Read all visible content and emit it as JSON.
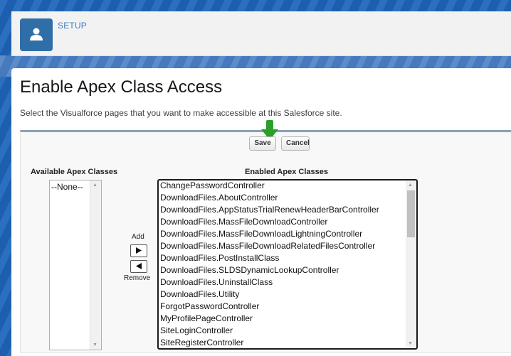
{
  "header": {
    "title": "SETUP",
    "icon": "user-icon",
    "icon_color": "#2f6ea7"
  },
  "main": {
    "page_title": "Enable Apex Class Access",
    "description": "Select the Visualforce pages that you want to make accessible at this Salesforce site."
  },
  "toolbar": {
    "save_label": "Save",
    "cancel_label": "Cancel"
  },
  "available": {
    "label": "Available Apex Classes",
    "items": [
      "--None--"
    ]
  },
  "mover": {
    "add_label": "Add",
    "remove_label": "Remove"
  },
  "enabled": {
    "label": "Enabled Apex Classes",
    "items": [
      "ChangePasswordController",
      "DownloadFiles.AboutController",
      "DownloadFiles.AppStatusTrialRenewHeaderBarController",
      "DownloadFiles.MassFileDownloadController",
      "DownloadFiles.MassFileDownloadLightningController",
      "DownloadFiles.MassFileDownloadRelatedFilesController",
      "DownloadFiles.PostInstallClass",
      "DownloadFiles.SLDSDynamicLookupController",
      "DownloadFiles.UninstallClass",
      "DownloadFiles.Utility",
      "ForgotPasswordController",
      "MyProfilePageController",
      "SiteLoginController",
      "SiteRegisterController"
    ]
  },
  "colors": {
    "annotation_arrow": "#2aa02a",
    "panel_accent": "#8aa0b8"
  }
}
